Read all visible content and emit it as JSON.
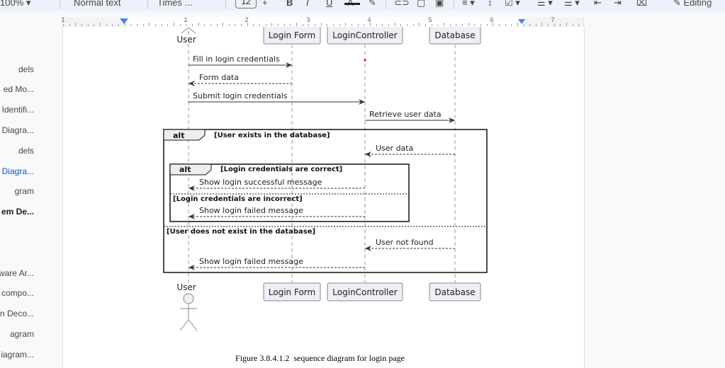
{
  "toolbar": {
    "zoom": "100%",
    "style": "Normal text",
    "font": "Times ...",
    "font_size": "12",
    "mode": "Editing"
  },
  "ruler": {
    "labels": [
      "1",
      "1",
      "2",
      "3",
      "4",
      "5",
      "6",
      "7"
    ]
  },
  "outline": {
    "items": [
      {
        "label": "dels"
      },
      {
        "label": "ed Mo..."
      },
      {
        "label": "Identifi..."
      },
      {
        "label": "Diagra..."
      },
      {
        "label": "dels"
      },
      {
        "label": "Diagra..."
      },
      {
        "label": "gram"
      },
      {
        "label": "em De..."
      },
      {
        "label": "ware Ar..."
      },
      {
        "label": "compo..."
      },
      {
        "label": "n Deco..."
      },
      {
        "label": "agram"
      },
      {
        "label": "iagram..."
      }
    ]
  },
  "diagram": {
    "participants": [
      "User",
      "Login Form",
      "LoginController",
      "Database"
    ],
    "messages": [
      "Fill in login credentials",
      "Form data",
      "Submit login credentials",
      "Retrieve user data",
      "User data",
      "Show login successful message",
      "Show login failed message",
      "User not found",
      "Show login failed message"
    ],
    "fragments": {
      "alt_label": "alt",
      "outer_guard_1": "[User exists in the database]",
      "outer_guard_2": "[User does not exist in the database]",
      "inner_guard_1": "[Login credentials are correct]",
      "inner_guard_2": "[Login credentials are incorrect]"
    }
  },
  "caption": "Figure 3.8.4.1.2  sequence diagram for login page"
}
